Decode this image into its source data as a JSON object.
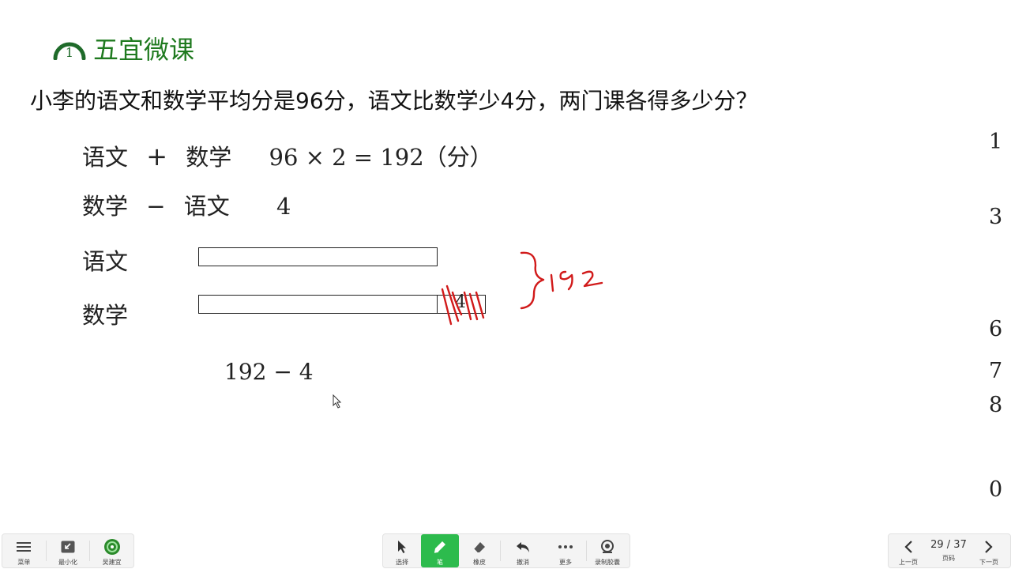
{
  "brand": {
    "logo_digit": "1",
    "name": "五宜微课"
  },
  "question": "小李的语文和数学平均分是96分，语文比数学少4分，两门课各得多少分？",
  "lines": {
    "line1": {
      "left": "语文",
      "op": "+",
      "right": "数学",
      "calc": "96 × 2 = 192（分）"
    },
    "line2": {
      "left": "数学",
      "op": "−",
      "right": "语文",
      "value": "4"
    }
  },
  "diagram": {
    "label_chinese": "语文",
    "label_math": "数学",
    "extra_label": "4"
  },
  "calculation": "192 − 4",
  "side_numbers": [
    "1",
    "3",
    "6",
    "7",
    "8",
    "0"
  ],
  "toolbar": {
    "left": {
      "menu": "菜单",
      "minimize": "最小化",
      "user": "吴建宜"
    },
    "mid": {
      "select": "选择",
      "pen": "笔",
      "eraser": "橡皮",
      "undo": "撤消",
      "more": "更多",
      "record": "录制胶囊"
    },
    "right": {
      "prev": "上一页",
      "page_label": "页码",
      "page": "29 / 37",
      "next": "下一页"
    }
  },
  "colors": {
    "brand": "#1f7a1f",
    "active": "#2dbb4d",
    "ink": "#d11a1a"
  }
}
